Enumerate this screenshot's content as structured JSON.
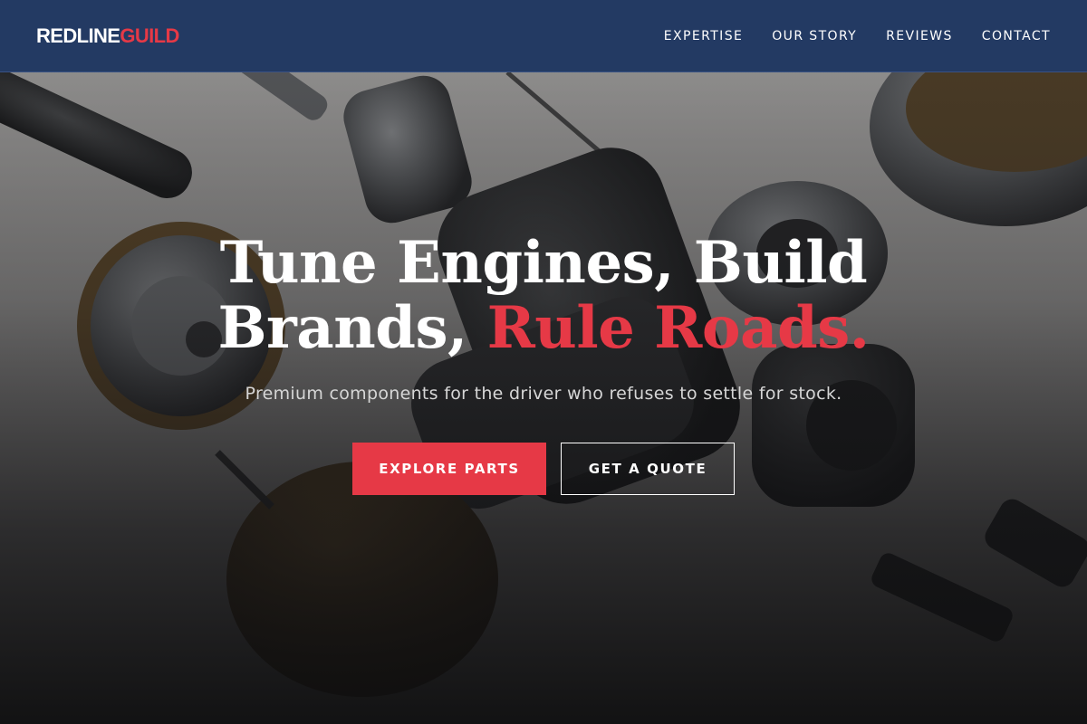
{
  "header": {
    "logo_part1": "REDLINE",
    "logo_part2": "GUILD",
    "nav": [
      {
        "label": "EXPERTISE"
      },
      {
        "label": "OUR STORY"
      },
      {
        "label": "REVIEWS"
      },
      {
        "label": "CONTACT"
      }
    ]
  },
  "hero": {
    "headline_line1": "Tune Engines, Build",
    "headline_line2_white": "Brands, ",
    "headline_line2_red": "Rule Roads.",
    "subtitle": "Premium components for the driver who refuses to settle for stock.",
    "primary_button": "EXPLORE PARTS",
    "secondary_button": "GET A QUOTE",
    "background_image": "engine-parts-photo"
  },
  "colors": {
    "accent": "#e63946",
    "header_bg": "#233a63",
    "text": "#ffffff"
  }
}
